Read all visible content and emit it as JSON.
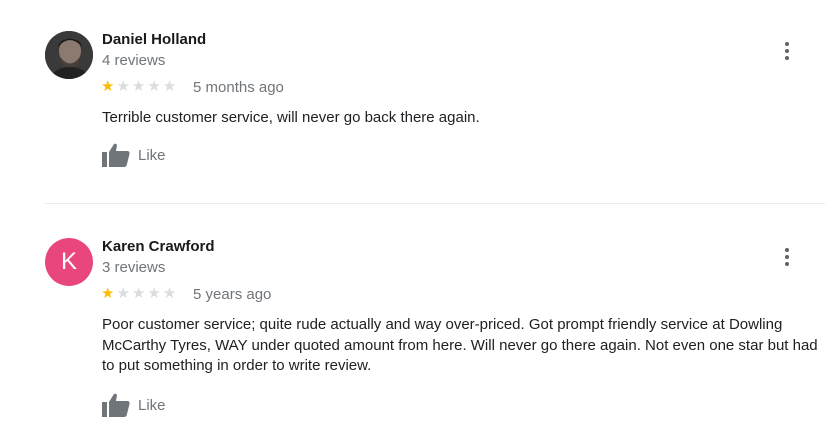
{
  "reviews": [
    {
      "author": "Daniel Holland",
      "review_count": "4 reviews",
      "rating": 1,
      "max_rating": 5,
      "time_ago": "5 months ago",
      "text": "Terrible customer service, will never go back there again.",
      "like_label": "Like",
      "avatar": {
        "type": "photo"
      }
    },
    {
      "author": "Karen Crawford",
      "review_count": "3 reviews",
      "rating": 1,
      "max_rating": 5,
      "time_ago": "5 years ago",
      "text": "Poor customer service; quite rude actually and way over-priced.  Got prompt friendly service at Dowling McCarthy Tyres, WAY under quoted amount from here.  Will never go there again. Not even one star but had to put something in order to write review.",
      "like_label": "Like",
      "avatar": {
        "type": "letter",
        "letter": "K",
        "color": "#e8467c"
      }
    }
  ],
  "colors": {
    "star_filled": "#fbbc04",
    "star_empty": "#dadce0",
    "muted_text": "#70757a"
  },
  "icons": {
    "like": "thumbs-up-icon",
    "menu": "more-vert-icon"
  }
}
